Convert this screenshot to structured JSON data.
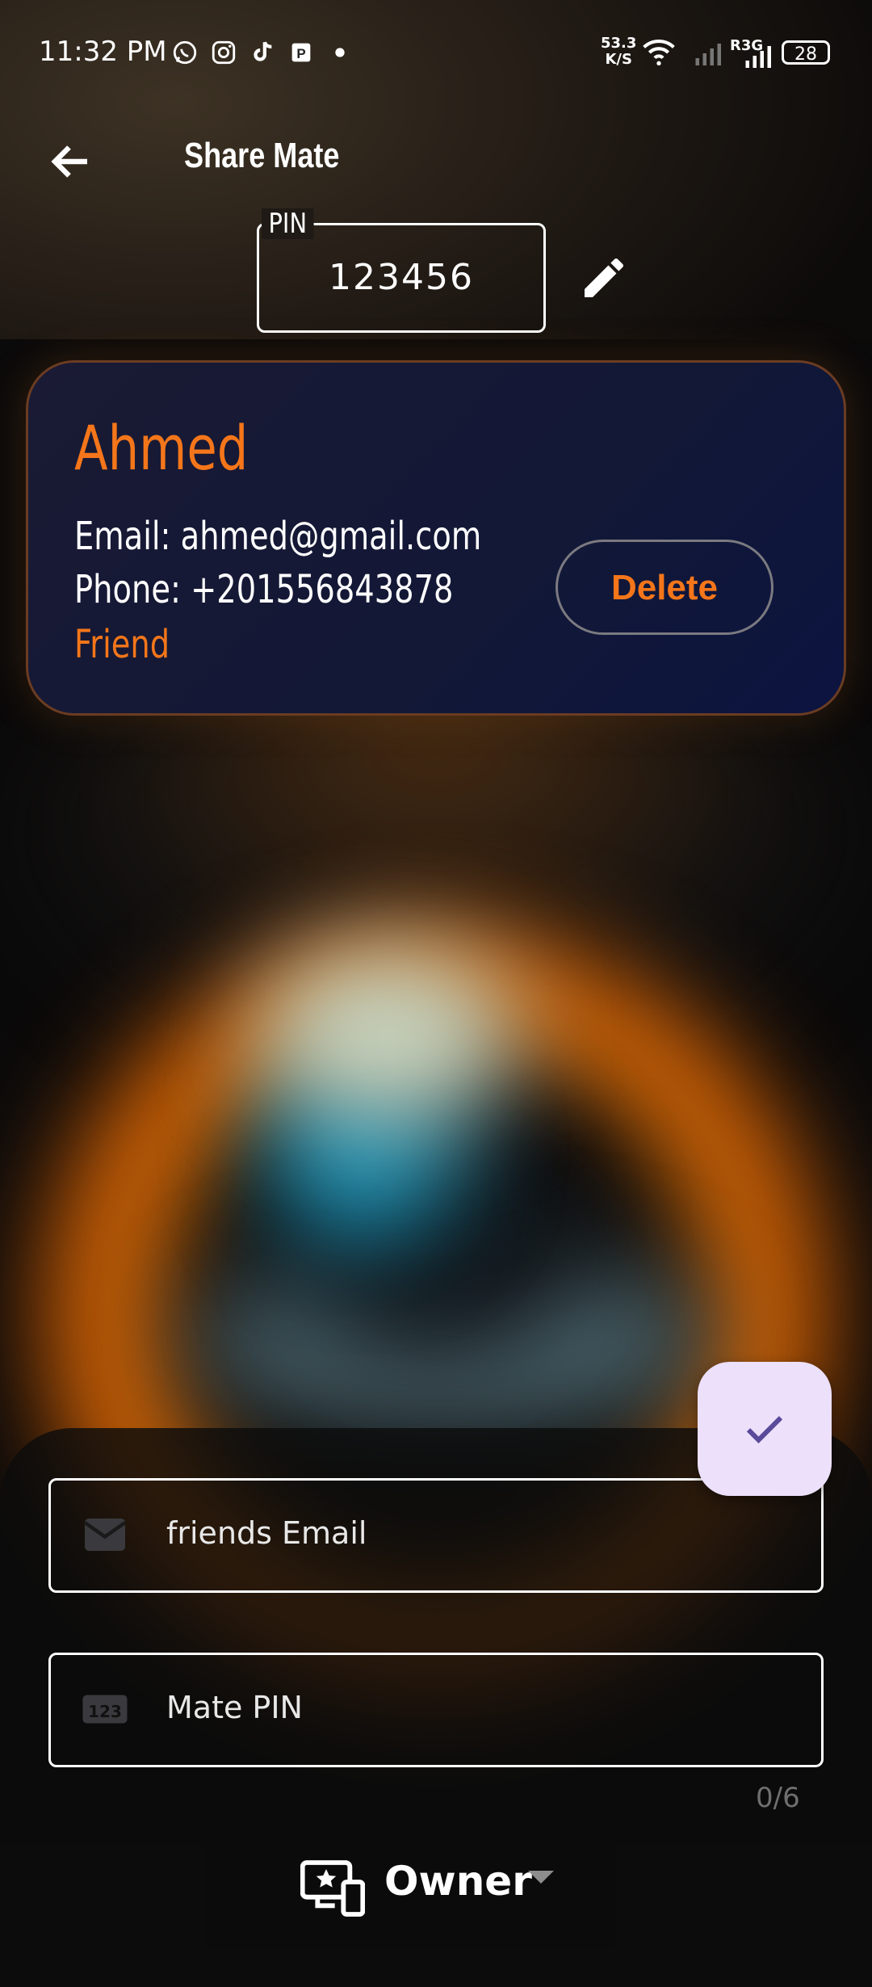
{
  "status_bar": {
    "time": "11:32 PM",
    "net_speed_value": "53.3",
    "net_speed_unit": "K/S",
    "network_type": "R3G",
    "battery": "28",
    "app_icons": [
      "whatsapp-icon",
      "instagram-icon",
      "tiktok-icon",
      "powerpoint-icon"
    ]
  },
  "app_bar": {
    "title": "Share Mate"
  },
  "pin": {
    "label": "PIN",
    "value": "123456"
  },
  "mate_card": {
    "name": "Ahmed",
    "email_line": "Email: ahmed@gmail.com",
    "phone_line": "Phone: +201556843878",
    "relation": "Friend",
    "delete_label": "Delete"
  },
  "form": {
    "email_placeholder": "friends Email",
    "pin_placeholder": "Mate PIN",
    "pin_counter": "0/6",
    "role_value": "Owner"
  },
  "colors": {
    "accent": "#f5761a",
    "card_bg": "#121836",
    "fab_bg": "#ece0fb",
    "fab_icon": "#5a4a9a"
  }
}
